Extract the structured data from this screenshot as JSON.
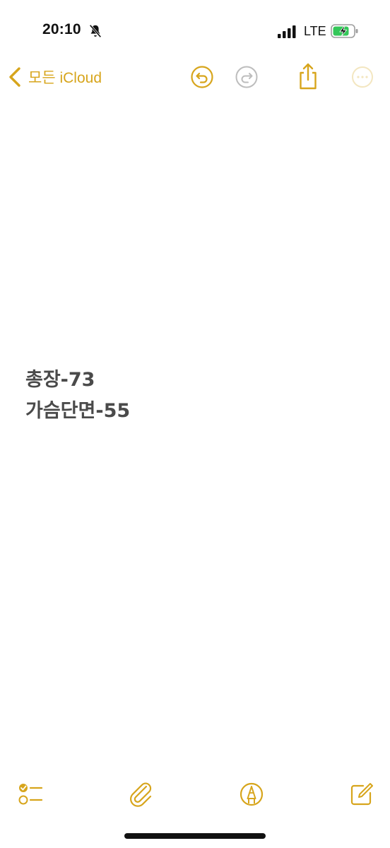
{
  "status_bar": {
    "time": "20:10",
    "carrier": "LTE",
    "icons": [
      "bell-slash-icon",
      "signal-bars-icon",
      "battery-charging-icon"
    ]
  },
  "nav": {
    "back_label": "모든 iCloud",
    "icons": [
      "chevron-left-icon",
      "undo-icon",
      "redo-icon",
      "share-icon",
      "more-icon"
    ]
  },
  "note": {
    "lines": [
      "총장-73",
      "가슴단면-55"
    ]
  },
  "toolbar": {
    "icons": [
      "checklist-icon",
      "paperclip-icon",
      "markup-pen-icon",
      "compose-icon"
    ]
  },
  "colors": {
    "accent": "#d7a51c",
    "disabled": "#bdbdbd",
    "text": "#4a4a4a",
    "battery_green": "#34c759"
  }
}
